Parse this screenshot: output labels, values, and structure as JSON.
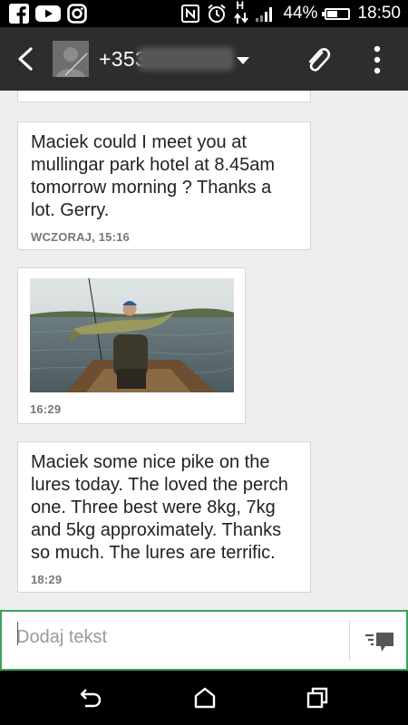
{
  "status_bar": {
    "battery_percent": "44%",
    "time": "18:50",
    "network_type": "H",
    "left_icons": [
      "facebook-icon",
      "youtube-icon",
      "instagram-icon"
    ],
    "right_icons": [
      "nfc-icon",
      "alarm-icon",
      "network-activity-icon",
      "signal-icon",
      "battery-icon"
    ]
  },
  "header": {
    "contact_number_visible": "+353",
    "icons": [
      "back-icon",
      "avatar",
      "chevron-down-icon",
      "paperclip-icon",
      "more-vert-icon"
    ]
  },
  "messages": [
    {
      "text": "Maciek could I meet you at mullingar park hotel at 8.45am tomorrow morning ? Thanks a lot. Gerry.",
      "time": "WCZORAJ, 15:16"
    },
    {
      "type": "image",
      "description_icon": "photo-attachment",
      "time": "16:29"
    },
    {
      "text": "Maciek some nice pike on the lures today. The loved the perch one. Three best were 8kg, 7kg and 5kg approximately. Thanks so much. The lures are terrific.",
      "time": "18:29"
    }
  ],
  "compose": {
    "placeholder": "Dodaj tekst",
    "value": "",
    "send_icon": "send-icon"
  },
  "nav_bar": {
    "icons": [
      "back-nav-icon",
      "home-icon",
      "recents-icon"
    ]
  },
  "colors": {
    "action_bar": "#2d2d2d",
    "conversation_bg": "#eeeeee",
    "compose_border": "#3aa35d"
  }
}
